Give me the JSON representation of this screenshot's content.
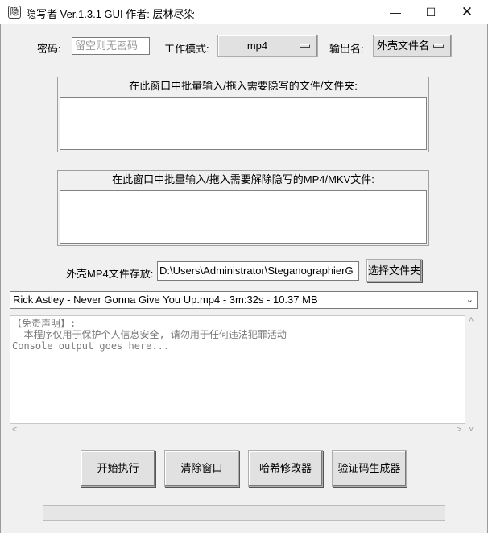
{
  "window": {
    "title": "隐写者 Ver.1.3.1 GUI 作者: 层林尽染",
    "app_icon_glyph": "隐",
    "controls": {
      "minimize": "—",
      "maximize": "☐",
      "close": "✕"
    }
  },
  "settings": {
    "password_label": "密码:",
    "password_placeholder": "留空则无密码",
    "mode_label": "工作模式:",
    "mode_value": "mp4",
    "output_label": "输出名:",
    "output_value": "外壳文件名"
  },
  "hide_frame": {
    "title": "在此窗口中批量输入/拖入需要隐写的文件/文件夹:"
  },
  "reveal_frame": {
    "title": "在此窗口中批量输入/拖入需要解除隐写的MP4/MKV文件:"
  },
  "shell_dir": {
    "label": "外壳MP4文件存放:",
    "path": "D:\\Users\\Administrator\\SteganographierG",
    "choose_button": "选择文件夹"
  },
  "shell_file": {
    "selected": "Rick Astley - Never Gonna Give You Up.mp4 - 3m:32s - 10.37 MB"
  },
  "console": {
    "lines": [
      "【免责声明】:",
      "--本程序仅用于保护个人信息安全, 请勿用于任何违法犯罪活动--",
      "Console output goes here..."
    ]
  },
  "actions": {
    "start": "开始执行",
    "clear": "清除窗口",
    "hash": "哈希修改器",
    "captcha": "验证码生成器"
  },
  "progress": {
    "value": 0
  }
}
